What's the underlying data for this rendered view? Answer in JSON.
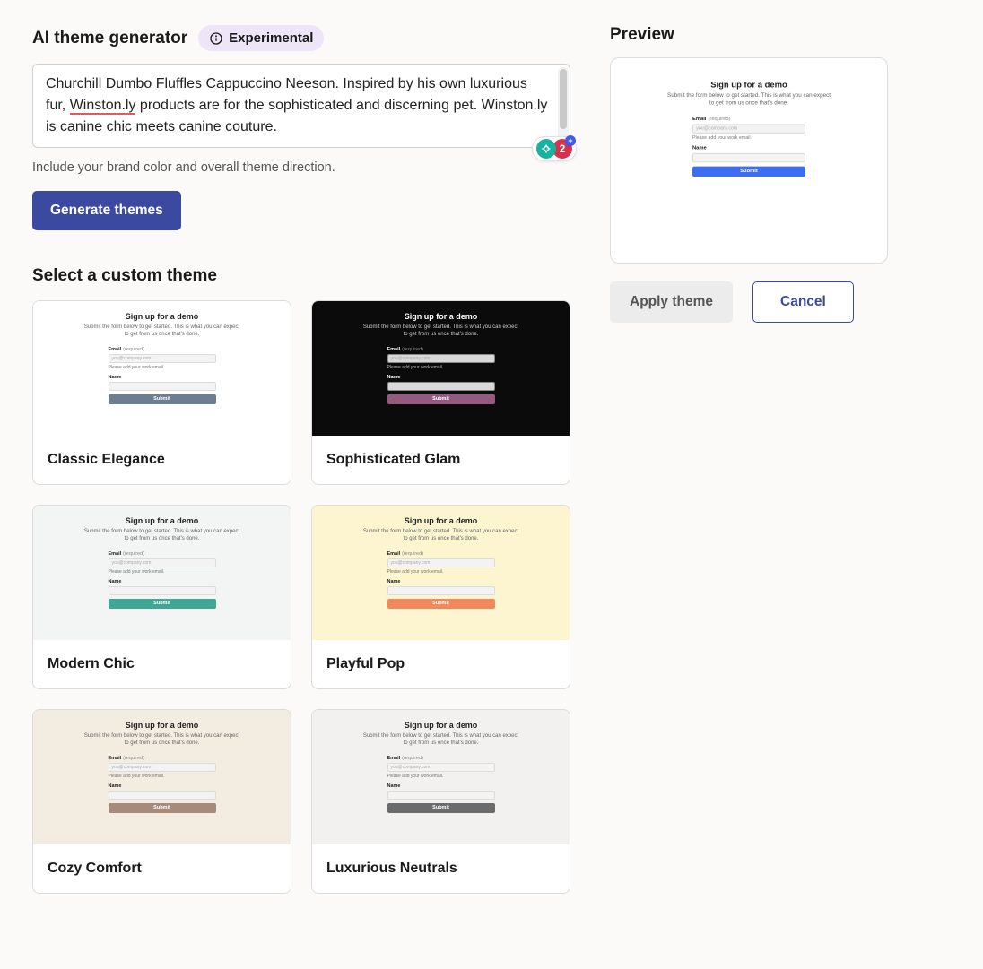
{
  "header": {
    "title": "AI theme generator",
    "badge": "Experimental"
  },
  "prompt": {
    "text_before": "Churchill Dumbo Fluffles Cappuccino Neeson. Inspired by his own luxurious fur, ",
    "spell_word": "Winston.ly",
    "text_after": " products are for the sophisticated and discerning pet. Winston.ly is canine chic meets canine couture.",
    "hint": "Include your brand color and overall theme direction.",
    "pill_count": "2"
  },
  "buttons": {
    "generate": "Generate themes",
    "apply": "Apply theme",
    "cancel": "Cancel"
  },
  "select_title": "Select a custom theme",
  "preview_title": "Preview",
  "mini": {
    "title": "Sign up for a demo",
    "sub": "Submit the form below to get started. This is what you can expect to get from us once that's done.",
    "email_label": "Email",
    "required": "(required)",
    "placeholder": "you@company.com",
    "email_hint": "Please add your work email.",
    "name_label": "Name",
    "submit": "Submit"
  },
  "themes": [
    {
      "name": "Classic Elegance",
      "bg": "bg-white",
      "btn": "btn-slate"
    },
    {
      "name": "Sophisticated Glam",
      "bg": "bg-black",
      "btn": "btn-plum"
    },
    {
      "name": "Modern Chic",
      "bg": "bg-ltgray",
      "btn": "btn-teal"
    },
    {
      "name": "Playful Pop",
      "bg": "bg-cream",
      "btn": "btn-orange"
    },
    {
      "name": "Cozy Comfort",
      "bg": "bg-beige",
      "btn": "btn-taupe"
    },
    {
      "name": "Luxurious Neutrals",
      "bg": "bg-warmgray",
      "btn": "btn-gray"
    }
  ],
  "preview_theme": {
    "bg": "bg-lightblue",
    "btn": "btn-blue"
  }
}
